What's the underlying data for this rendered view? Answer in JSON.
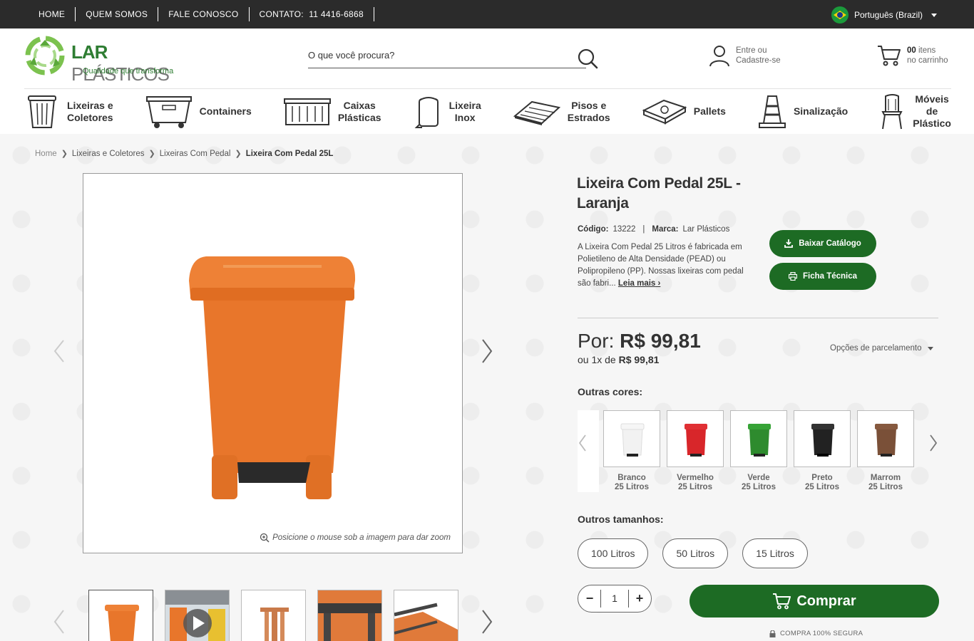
{
  "topbar": {
    "links": [
      "HOME",
      "QUEM SOMOS",
      "FALE CONOSCO"
    ],
    "contact_label": "CONTATO:",
    "contact_phone": "11 4416-6868",
    "language": "Português (Brazil)"
  },
  "header": {
    "logo_word_1": "LAR",
    "logo_word_2": "PLÁSTICOS",
    "logo_tagline": "Qualidade que transforma",
    "search_placeholder": "O que você procura?",
    "account_line1": "Entre ou",
    "account_line2": "Cadastre-se",
    "cart_count": "00",
    "cart_count_suffix": " itens",
    "cart_line2": "no carrinho"
  },
  "categories": [
    {
      "label": "Lixeiras e\nColetores",
      "icon": "trash-bin-icon"
    },
    {
      "label": "Containers",
      "icon": "container-icon"
    },
    {
      "label": "Caixas\nPlásticas",
      "icon": "crate-icon"
    },
    {
      "label": "Lixeira\nInox",
      "icon": "steel-bin-icon"
    },
    {
      "label": "Pisos e\nEstrados",
      "icon": "floor-tile-icon"
    },
    {
      "label": "Pallets",
      "icon": "pallet-icon"
    },
    {
      "label": "Sinalização",
      "icon": "traffic-cone-icon"
    },
    {
      "label": "Móveis\nde\nPlástico",
      "icon": "chair-icon"
    }
  ],
  "breadcrumb": {
    "items": [
      "Home",
      "Lixeiras e Coletores",
      "Lixeiras Com Pedal"
    ],
    "current": "Lixeira Com Pedal 25L"
  },
  "gallery": {
    "zoom_hint": "Posicione o mouse sob a imagem para dar zoom",
    "main_color": "#e8762b"
  },
  "product": {
    "title": "Lixeira Com Pedal 25L - Laranja",
    "code_label": "Código:",
    "code": "13222",
    "brand_label": "Marca:",
    "brand": "Lar Plásticos",
    "description": "A Lixeira Com Pedal 25 Litros é fabricada em Polietileno de Alta Densidade (PEAD) ou Polipropileno (PP). Nossas lixeiras com pedal são fabri...",
    "read_more": "Leia mais",
    "catalog_button": "Baixar Catálogo",
    "sheet_button": "Ficha Técnica",
    "price_prefix": "Por:",
    "price": "R$ 99,81",
    "installment_prefix": "ou 1x de",
    "installment_value": "R$ 99,81",
    "installment_options": "Opções de parcelamento",
    "other_colors_label": "Outras cores:",
    "colors": [
      {
        "name": "Branco",
        "size": "25 Litros",
        "hex": "#f2f2f2"
      },
      {
        "name": "Vermelho",
        "size": "25 Litros",
        "hex": "#d8262a"
      },
      {
        "name": "Verde",
        "size": "25 Litros",
        "hex": "#2e8b2e"
      },
      {
        "name": "Preto",
        "size": "25 Litros",
        "hex": "#222222"
      },
      {
        "name": "Marrom",
        "size": "25 Litros",
        "hex": "#7a5038"
      }
    ],
    "other_sizes_label": "Outros tamanhos:",
    "sizes": [
      "100 Litros",
      "50 Litros",
      "15 Litros"
    ],
    "quantity": "1",
    "buy_button": "Comprar",
    "secure_text": "COMPRA 100% SEGURA",
    "accent": "#1d6b24"
  }
}
